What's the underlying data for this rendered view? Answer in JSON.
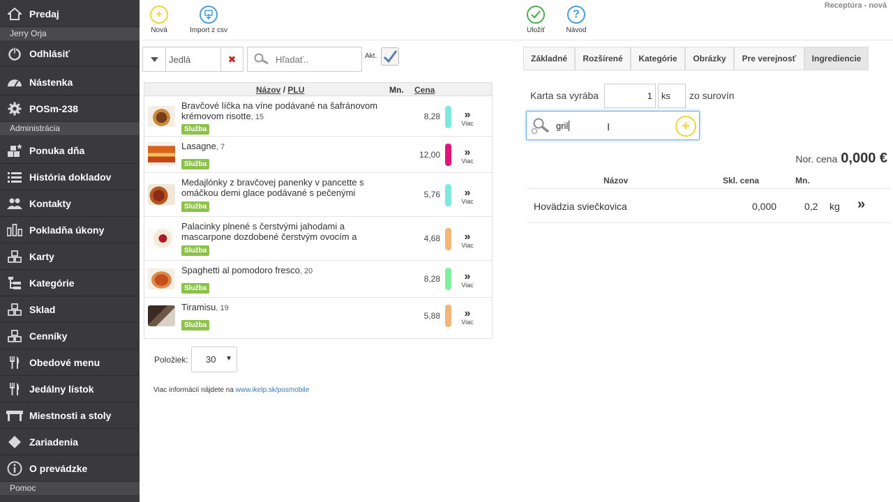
{
  "sidebar": {
    "predaj": "Predaj",
    "user": "Jerry Orja",
    "logout": "Odhlásiť",
    "dashboard": "Nástenka",
    "device": "POSm-238",
    "section_admin": "Administrácia",
    "items": [
      {
        "label": "Ponuka dňa",
        "icon": "star-blocks-icon"
      },
      {
        "label": "História dokladov",
        "icon": "list-icon"
      },
      {
        "label": "Kontakty",
        "icon": "users-icon"
      },
      {
        "label": "Pokladňa úkony",
        "icon": "bars-icon"
      },
      {
        "label": "Karty",
        "icon": "blocks-icon"
      },
      {
        "label": "Kategórie",
        "icon": "tree-icon"
      },
      {
        "label": "Sklad",
        "icon": "blocks-icon"
      },
      {
        "label": "Cenníky",
        "icon": "blocks-icon"
      },
      {
        "label": "Obedové menu",
        "icon": "fork-knife-icon"
      },
      {
        "label": "Jedálny lístok",
        "icon": "fork-knife-icon"
      },
      {
        "label": "Miestnosti a stoly",
        "icon": "table-icon"
      },
      {
        "label": "Zariadenia",
        "icon": "diamond-icon"
      },
      {
        "label": "O prevádzke",
        "icon": "info-icon"
      }
    ],
    "section_help": "Pomoc"
  },
  "toolbar": {
    "new": "Nová",
    "import": "Import z csv",
    "save": "Uložiť",
    "guide": "Návod",
    "page_title": "Receptúra - nová"
  },
  "filter": {
    "category": "Jedlá",
    "search_placeholder": "Hľadať..",
    "active_label": "Akt."
  },
  "list": {
    "col_name": "Názov",
    "col_sep": "/",
    "col_plu": "PLU",
    "col_qty": "Mn.",
    "col_price": "Cena",
    "more_label": "Viac",
    "rows": [
      {
        "name": "Bravčové líčka na víne podávané na šafránovom krémovom risotte",
        "plu": ", 15",
        "badge": "Služba",
        "price": "8,28",
        "color": "#7fe8e0"
      },
      {
        "name": "Lasagne",
        "plu": ", 7",
        "badge": "Služba",
        "price": "12,00",
        "color": "#e0147a"
      },
      {
        "name": "Medajlónky z bravčovej panenky v pancette s omáčkou demi glace podávané s pečenými",
        "plu": "",
        "badge": "Služba",
        "price": "5,76",
        "color": "#7fe8e0"
      },
      {
        "name": "Palacinky plnené s čerstvými jahodami a mascarpone dozdobené čerstvým ovocím a",
        "plu": "",
        "badge": "Služba",
        "price": "4,68",
        "color": "#f0b878"
      },
      {
        "name": "Spaghetti al pomodoro fresco",
        "plu": ", 20",
        "badge": "Služba",
        "price": "8,28",
        "color": "#7ff0a0"
      },
      {
        "name": "Tiramisu",
        "plu": ", 19",
        "badge": "Služba",
        "price": "5,88",
        "color": "#f0b878"
      }
    ]
  },
  "pager": {
    "label": "Položiek:",
    "value": "30"
  },
  "footer": {
    "text": "Viac informácií nájdete na",
    "link": "www.ikelp.sk/posmobile"
  },
  "tabs": [
    "Základné",
    "Rozšírené",
    "Kategórie",
    "Obrázky",
    "Pre verejnosť",
    "Ingrediencie"
  ],
  "recipe": {
    "label": "Karta sa vyrába",
    "qty": "1",
    "unit": "ks",
    "suffix": "zo surovín",
    "search_value": "gril",
    "nor_label": "Nor. cena",
    "nor_value": "0,000 €"
  },
  "ingredients": {
    "col_name": "Názov",
    "col_price": "Skl. cena",
    "col_qty": "Mn.",
    "rows": [
      {
        "name": "Hovädzia sviečkovica",
        "price": "0,000",
        "qty": "0,2",
        "unit": "kg"
      }
    ]
  },
  "colors": {
    "sidebar": "#3a3a3c",
    "badge": "#8bc34a",
    "new_btn": "#f5d623",
    "import_btn": "#4a9fd8",
    "save_btn": "#4caf50",
    "guide_btn": "#4a9fd8"
  }
}
